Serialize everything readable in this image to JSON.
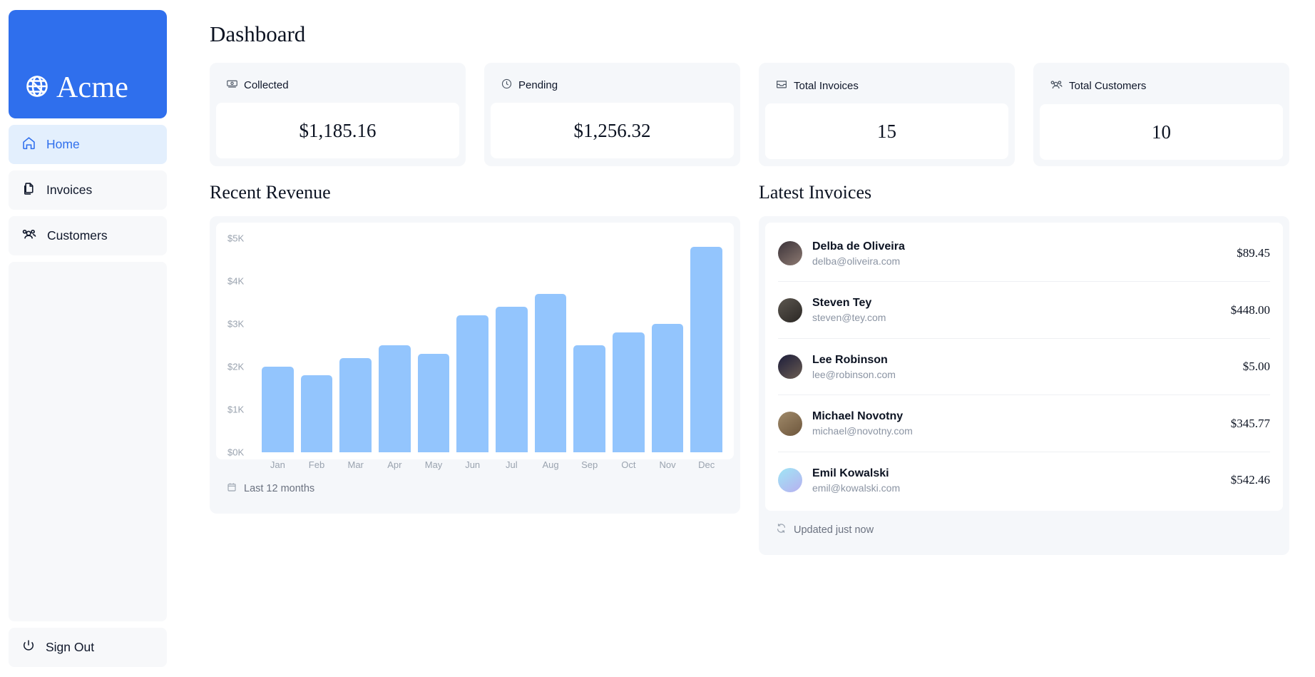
{
  "sidebar": {
    "logo": {
      "text": "Acme",
      "icon": "globe-icon",
      "background": "#2f6fed"
    },
    "items": [
      {
        "label": "Home",
        "icon": "home-icon",
        "active": true
      },
      {
        "label": "Invoices",
        "icon": "document-duplicate-icon",
        "active": false
      },
      {
        "label": "Customers",
        "icon": "user-group-icon",
        "active": false
      }
    ],
    "sign_out": {
      "label": "Sign Out",
      "icon": "power-icon"
    }
  },
  "main": {
    "page_title": "Dashboard",
    "stats": [
      {
        "label": "Collected",
        "value": "$1,185.16",
        "icon": "banknotes-icon"
      },
      {
        "label": "Pending",
        "value": "$1,256.32",
        "icon": "clock-icon"
      },
      {
        "label": "Total Invoices",
        "value": "15",
        "icon": "inbox-icon"
      },
      {
        "label": "Total Customers",
        "value": "10",
        "icon": "user-group-icon"
      }
    ],
    "revenue": {
      "title": "Recent Revenue",
      "footer_label": "Last 12 months",
      "footer_icon": "calendar-icon"
    },
    "invoices": {
      "title": "Latest Invoices",
      "footer_label": "Updated just now",
      "footer_icon": "refresh-icon",
      "rows": [
        {
          "name": "Delba de Oliveira",
          "email": "delba@oliveira.com",
          "amount": "$89.45",
          "avatar_colors": [
            "#3a3238",
            "#8d7a72"
          ]
        },
        {
          "name": "Steven Tey",
          "email": "steven@tey.com",
          "amount": "$448.00",
          "avatar_colors": [
            "#5c5750",
            "#2b2724"
          ]
        },
        {
          "name": "Lee Robinson",
          "email": "lee@robinson.com",
          "amount": "$5.00",
          "avatar_colors": [
            "#1b1c3a",
            "#6b5d52"
          ]
        },
        {
          "name": "Michael Novotny",
          "email": "michael@novotny.com",
          "amount": "$345.77",
          "avatar_colors": [
            "#a08a6a",
            "#6d563c"
          ]
        },
        {
          "name": "Emil Kowalski",
          "email": "emil@kowalski.com",
          "amount": "$542.46",
          "avatar_colors": [
            "#9fe6f5",
            "#b8b0f0"
          ]
        }
      ]
    }
  },
  "chart_data": {
    "type": "bar",
    "title": "Recent Revenue",
    "xlabel": "",
    "ylabel": "",
    "categories": [
      "Jan",
      "Feb",
      "Mar",
      "Apr",
      "May",
      "Jun",
      "Jul",
      "Aug",
      "Sep",
      "Oct",
      "Nov",
      "Dec"
    ],
    "values": [
      2000,
      1800,
      2200,
      2500,
      2300,
      3200,
      3400,
      3700,
      2500,
      2800,
      3000,
      4800
    ],
    "y_ticks": [
      "$5K",
      "$4K",
      "$3K",
      "$2K",
      "$1K",
      "$0K"
    ],
    "y_tick_values": [
      5000,
      4000,
      3000,
      2000,
      1000,
      0
    ],
    "ylim": [
      0,
      5000
    ],
    "grid": false,
    "legend": false,
    "bar_color": "#93c5fd"
  }
}
